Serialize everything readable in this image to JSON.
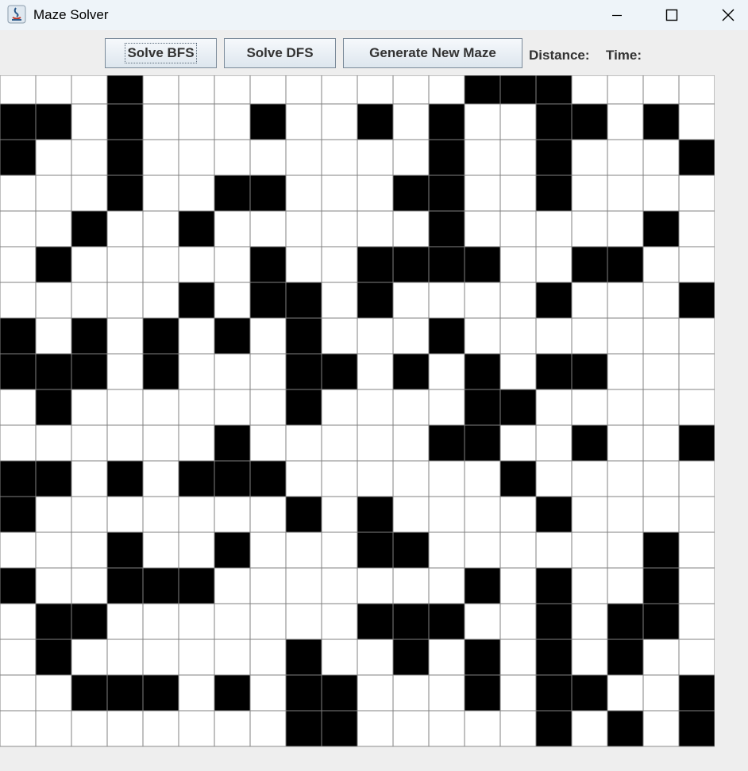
{
  "window": {
    "title": "Maze Solver",
    "controls": [
      "minimize-icon",
      "maximize-icon",
      "close-icon"
    ]
  },
  "toolbar": {
    "solve_bfs_label": "Solve BFS",
    "solve_dfs_label": "Solve DFS",
    "generate_label": "Generate New Maze",
    "distance_label": "Distance:",
    "time_label": "Time:"
  },
  "maze": {
    "rows": 19,
    "cols": 20,
    "wall_color": "#000000",
    "open_color": "#ffffff",
    "grid_line_color": "#808080",
    "grid": [
      "00010000000001110000",
      "11010001001010011010",
      "10010000000010010001",
      "00010011000110010000",
      "00100100000010000010",
      "01000001001111001100",
      "00000101101000010001",
      "10101010100010000000",
      "11101000110101011000",
      "01000000100001100000",
      "00000010000011001001",
      "11010111000000100000",
      "10000000101000010000",
      "00010010001100000010",
      "10011100000001010010",
      "01100000001110010110",
      "01000000100101010100",
      "00111010110001011001",
      "00000000110000010101"
    ]
  }
}
